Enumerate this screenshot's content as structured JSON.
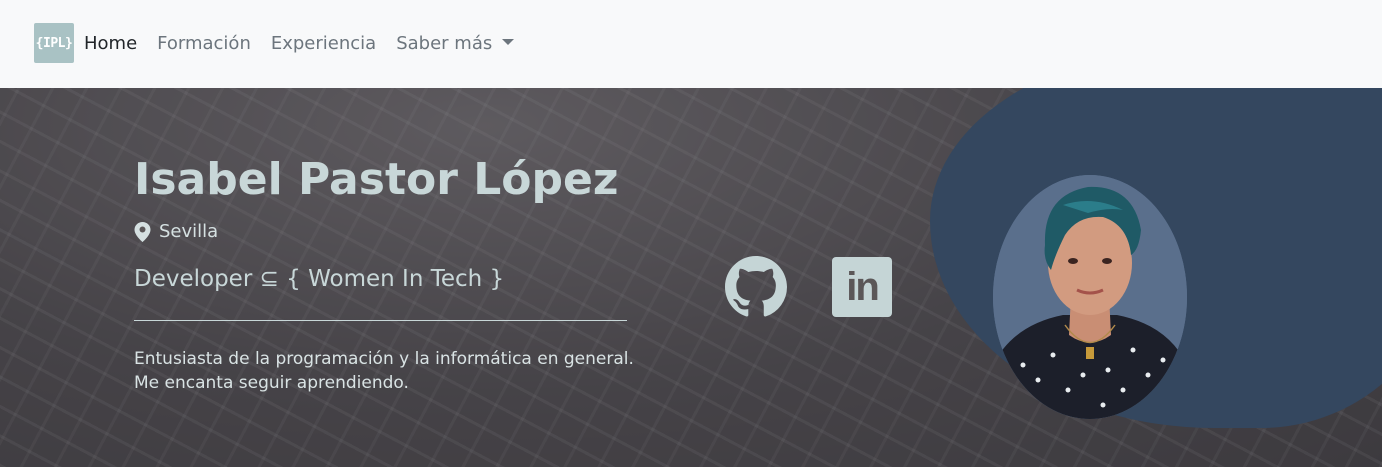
{
  "navbar": {
    "brand": "{IPL}",
    "links": [
      {
        "label": "Home",
        "active": true
      },
      {
        "label": "Formación",
        "active": false
      },
      {
        "label": "Experiencia",
        "active": false
      },
      {
        "label": "Saber más",
        "active": false,
        "dropdown": true
      }
    ]
  },
  "hero": {
    "name": "Isabel Pastor López",
    "location": "Sevilla",
    "role": "Developer ⊆ { Women In Tech }",
    "bio_line1": "Entusiasta de la programación y la informática en general.",
    "bio_line2": "Me encanta seguir aprendiendo.",
    "social": [
      {
        "icon": "github-icon"
      },
      {
        "icon": "linkedin-icon",
        "text": "in"
      }
    ]
  },
  "colors": {
    "navbar_bg": "#f8f9fa",
    "brand_bg": "#a9c2c4",
    "hero_text": "#c8d7d8",
    "blob": "#34475f"
  }
}
